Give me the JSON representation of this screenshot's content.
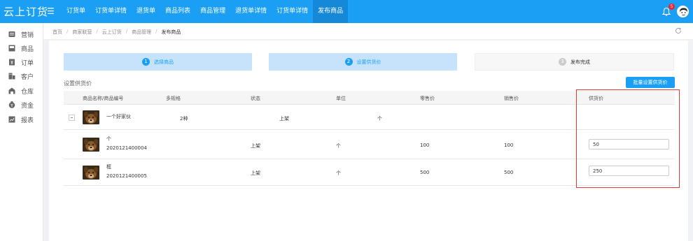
{
  "app": {
    "logo": "云上订货",
    "menu_icon": "menu-icon"
  },
  "topnav": {
    "items": [
      "订货单",
      "订货单详情",
      "退货单",
      "商品列表",
      "商品管理",
      "退货单详情",
      "订货单详情",
      "发布商品"
    ],
    "active_index": 7,
    "notification_count": "5"
  },
  "sidebar": {
    "items": [
      {
        "label": "营销",
        "icon": "marketing-icon"
      },
      {
        "label": "商品",
        "icon": "goods-icon"
      },
      {
        "label": "订单",
        "icon": "order-icon"
      },
      {
        "label": "客户",
        "icon": "customer-icon"
      },
      {
        "label": "仓库",
        "icon": "warehouse-icon"
      },
      {
        "label": "资金",
        "icon": "funds-icon"
      },
      {
        "label": "报表",
        "icon": "report-icon"
      }
    ]
  },
  "breadcrumb": {
    "items": [
      "首页",
      "商家联营",
      "云上订货",
      "商品管理",
      "发布商品"
    ]
  },
  "steps": [
    {
      "num": "1",
      "label": "选择商品"
    },
    {
      "num": "2",
      "label": "设置供货价"
    },
    {
      "num": "3",
      "label": "发布完成"
    }
  ],
  "section": {
    "title": "设置供货价",
    "batch_button": "批量设置供货价"
  },
  "table": {
    "headers": [
      "商品名称/商品编号",
      "多规格",
      "状态",
      "单位",
      "零售价",
      "销售价",
      "供货价"
    ],
    "parent": {
      "name": "一个好家伙",
      "spec": "2种",
      "status": "上架",
      "unit": "个"
    },
    "children": [
      {
        "name": "个",
        "code": "2020121400004",
        "status": "上架",
        "unit": "个",
        "retail": "100",
        "sale": "100",
        "supply": "50"
      },
      {
        "name": "框",
        "code": "2020121400005",
        "status": "上架",
        "unit": "个",
        "retail": "500",
        "sale": "500",
        "supply": "250"
      }
    ]
  },
  "colors": {
    "primary": "#1a9ff5",
    "step_active_bg": "#c6e3fb",
    "highlight": "#e53935",
    "badge": "#f5222d"
  }
}
